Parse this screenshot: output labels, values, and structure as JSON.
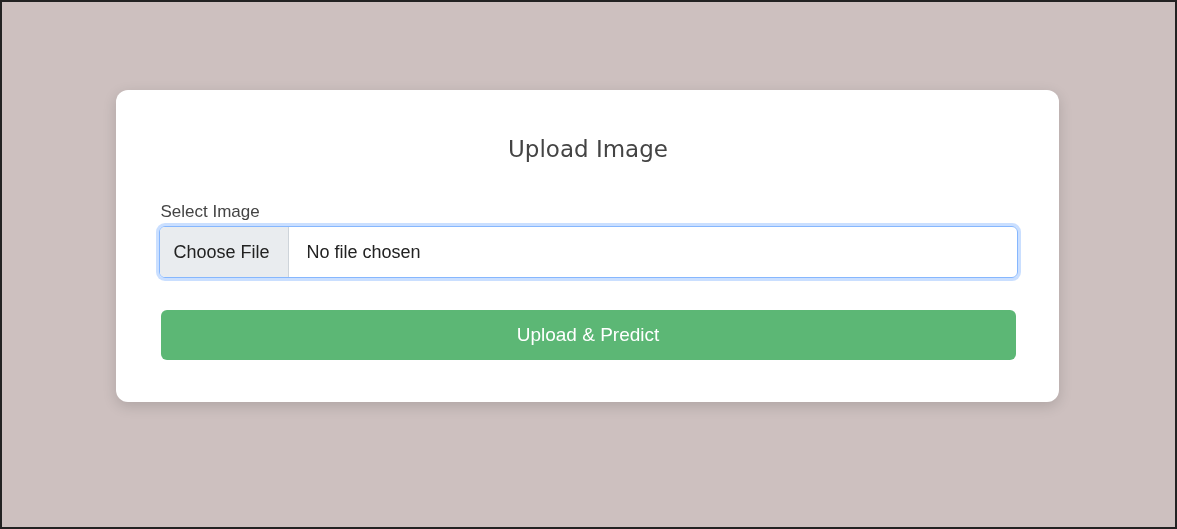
{
  "card": {
    "title": "Upload Image",
    "file_field": {
      "label": "Select Image",
      "button_label": "Choose File",
      "value": "No file chosen",
      "focused": true
    },
    "submit_button": {
      "label": "Upload & Predict"
    }
  }
}
